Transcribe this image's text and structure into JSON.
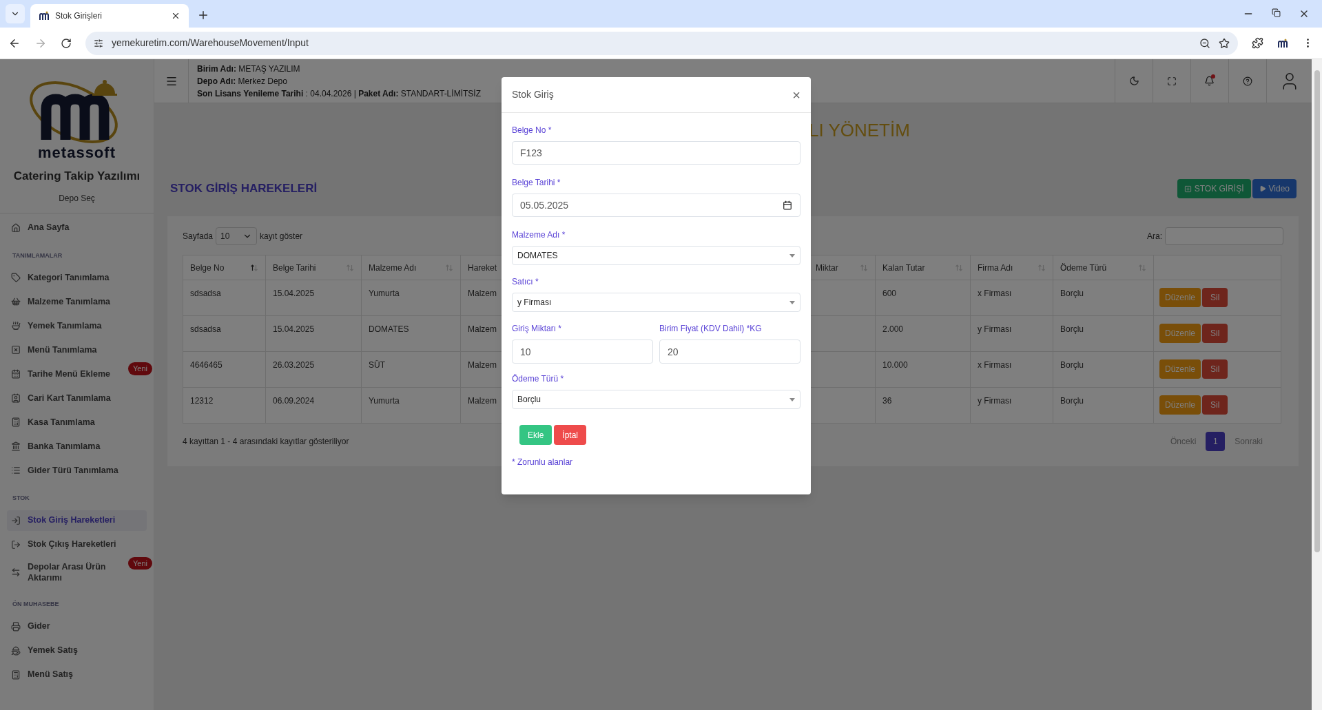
{
  "browser": {
    "tabs": [
      {
        "title": "Stok Girişleri",
        "selected": true
      }
    ],
    "url": "yemekuretim.com/WarehouseMovement/Input"
  },
  "sidebar": {
    "brand": "metassoft",
    "app_title": "Catering Takip Yazılımı",
    "depot_link": "Depo Seç",
    "sections": [
      {
        "items": [
          {
            "label": "Ana Sayfa",
            "selected": false
          }
        ]
      },
      {
        "title": "TANIMLAMALAR",
        "items": [
          {
            "label": "Kategori Tanımlama",
            "selected": false
          },
          {
            "label": "Malzeme Tanımlama",
            "selected": false
          },
          {
            "label": "Yemek Tanımlama",
            "selected": false
          },
          {
            "label": "Menü Tanımlama",
            "selected": false
          },
          {
            "label": "Tarihe Menü Ekleme",
            "selected": false,
            "badge": "Yeni"
          },
          {
            "label": "Cari Kart Tanımlama",
            "selected": false
          },
          {
            "label": "Kasa Tanımlama",
            "selected": false
          },
          {
            "label": "Banka Tanımlama",
            "selected": false
          },
          {
            "label": "Gider Türü Tanımlama",
            "selected": false
          }
        ]
      },
      {
        "title": "STOK",
        "items": [
          {
            "label": "Stok Giriş Hareketleri",
            "selected": true
          },
          {
            "label": "Stok Çıkış Hareketleri",
            "selected": false
          },
          {
            "label": "Depolar Arası Ürün Aktarımı",
            "selected": false,
            "badge": "Yeni"
          }
        ]
      },
      {
        "title": "ÖN MUHASEBE",
        "items": [
          {
            "label": "Gider",
            "selected": false
          },
          {
            "label": "Yemek Satış",
            "selected": false
          },
          {
            "label": "Menü Satış",
            "selected": false
          }
        ]
      }
    ]
  },
  "header": {
    "info_lines": [
      "**Birim Adı:** METAŞ YAZILIM",
      "**Depo Adı:** Merkez Depo",
      "**Son Lisans Yenileme Tarihi** : 04.04.2026 | **Paket Adı:** STANDART-LİMİTSİZ"
    ],
    "notification_dot": true
  },
  "banner": "LI YÖNETİM",
  "page_title": "STOK GİRİŞ HAREKELERİ",
  "actions": [
    {
      "label": "STOK GİRİŞİ",
      "kind": "add"
    },
    {
      "label": "Video",
      "kind": "video"
    }
  ],
  "table": {
    "length_prefix": "Sayfada",
    "length_value": "10",
    "length_suffix": "kayıt göster",
    "search_label": "Ara:",
    "columns": [
      {
        "label": "Belge No",
        "sorted": true
      },
      {
        "label": "Belge Tarihi",
        "sorted": false
      },
      {
        "label": "Malzeme Adı",
        "sorted": false
      },
      {
        "label": "Hareket"
      },
      {
        "label": "Miktar",
        "sorted": false
      },
      {
        "label": "Kalan Tutar",
        "sorted": false
      },
      {
        "label": "Firma Adı",
        "sorted": false
      },
      {
        "label": "Ödeme Türü",
        "sorted": false
      }
    ],
    "rows": [
      {
        "cells": [
          "sdsadsa",
          "15.04.2025",
          "Yumurta",
          "Malzem",
          "",
          "600",
          "x Firması",
          "Borçlu"
        ],
        "edit": "Düzenle",
        "delete": "Sil"
      },
      {
        "cells": [
          "sdsadsa",
          "15.04.2025",
          "DOMATES",
          "Malzem",
          "",
          "2.000",
          "y Firması",
          "Borçlu"
        ],
        "edit": "Düzenle",
        "delete": "Sil"
      },
      {
        "cells": [
          "4646465",
          "26.03.2025",
          "SÜT",
          "Malzem",
          "",
          "10.000",
          "x Firması",
          "Borçlu"
        ],
        "edit": "Düzenle",
        "delete": "Sil"
      },
      {
        "cells": [
          "12312",
          "06.09.2024",
          "Yumurta",
          "Malzem",
          "",
          "36",
          "y Firması",
          "Borçlu"
        ],
        "edit": "Düzenle",
        "delete": "Sil"
      }
    ],
    "info": "4 kayıttan 1 - 4 arasındaki kayıtlar gösteriliyor",
    "pagination": {
      "prev": "Önceki",
      "pages": [
        {
          "label": "1",
          "selected": true
        }
      ],
      "next": "Sonraki"
    }
  },
  "modal": {
    "title": "Stok Giriş",
    "close": "×",
    "fields": [
      {
        "kind": "input",
        "label": "Belge No *",
        "value": "F123"
      },
      {
        "kind": "date",
        "label": "Belge Tarihi *",
        "value": "05.05.2025"
      },
      {
        "kind": "select",
        "label": "Malzeme Adı *",
        "value": "DOMATES"
      },
      {
        "kind": "select",
        "label": "Satıcı *",
        "value": "y Firması"
      },
      {
        "kind": "pair",
        "items": [
          {
            "label": "Giriş Miktarı *",
            "value": "10"
          },
          {
            "label": "Birim Fiyat (KDV Dahil) *KG",
            "value": "20"
          }
        ]
      },
      {
        "kind": "select",
        "label": "Ödeme Türü *",
        "value": "Borçlu"
      }
    ],
    "submit": "Ekle",
    "cancel": "İptal",
    "note": "* Zorunlu alanlar"
  }
}
